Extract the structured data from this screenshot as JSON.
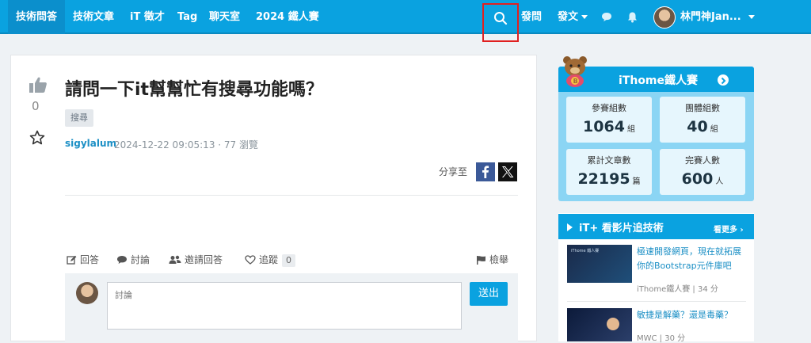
{
  "nav": {
    "items": [
      "技術問答",
      "技術文章",
      "iT 徵才",
      "Tag",
      "聊天室",
      "2024 鐵人賽"
    ],
    "ask_label": "發問",
    "post_label": "發文",
    "username": "林門神Jan..."
  },
  "question": {
    "title": "請問一下it幫幫忙有搜尋功能嗎？",
    "like_count": "0",
    "tag": "搜尋",
    "author": "sigylalum",
    "meta": "2024-12-22 09:05:13 · 77 瀏覽",
    "share_label": "分享至"
  },
  "actions": {
    "answer": "回答",
    "discuss": "討論",
    "invite": "邀請回答",
    "follow": "追蹤",
    "follow_count": "0",
    "report": "檢舉"
  },
  "comment": {
    "placeholder": "討論",
    "send_label": "送出"
  },
  "ironman": {
    "title": "iThome鐵人賽",
    "stats": [
      {
        "label": "參賽組數",
        "value": "1064",
        "unit": "組"
      },
      {
        "label": "團體組數",
        "value": "40",
        "unit": "組"
      },
      {
        "label": "累計文章數",
        "value": "22195",
        "unit": "篇"
      },
      {
        "label": "完賽人數",
        "value": "600",
        "unit": "人"
      }
    ]
  },
  "videos": {
    "title": "iT+ 看影片追技術",
    "more": "看更多 ›",
    "items": [
      {
        "title": "極速開發網頁，現在就拓展你的Bootstrap元件庫吧",
        "meta": "iThome鐵人賽 | 34 分",
        "thumb_text": "iThome 鐵人賽"
      },
      {
        "title": "敏捷是解藥？還是毒藥？",
        "meta": "MWC | 30 分"
      }
    ]
  },
  "colors": {
    "accent": "#0aa2e0",
    "link": "#1b8fc5",
    "highlight": "#e02020"
  }
}
